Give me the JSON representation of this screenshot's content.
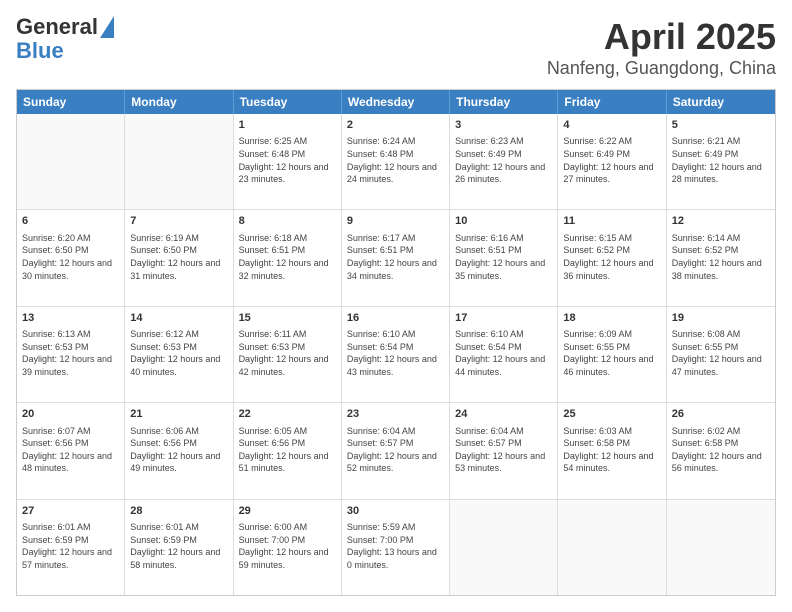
{
  "header": {
    "logo_general": "General",
    "logo_blue": "Blue",
    "title": "April 2025",
    "subtitle": "Nanfeng, Guangdong, China"
  },
  "calendar": {
    "days": [
      "Sunday",
      "Monday",
      "Tuesday",
      "Wednesday",
      "Thursday",
      "Friday",
      "Saturday"
    ],
    "weeks": [
      [
        {
          "day": "",
          "empty": true
        },
        {
          "day": "",
          "empty": true
        },
        {
          "day": "1",
          "sunrise": "6:25 AM",
          "sunset": "6:48 PM",
          "daylight": "12 hours and 23 minutes."
        },
        {
          "day": "2",
          "sunrise": "6:24 AM",
          "sunset": "6:48 PM",
          "daylight": "12 hours and 24 minutes."
        },
        {
          "day": "3",
          "sunrise": "6:23 AM",
          "sunset": "6:49 PM",
          "daylight": "12 hours and 26 minutes."
        },
        {
          "day": "4",
          "sunrise": "6:22 AM",
          "sunset": "6:49 PM",
          "daylight": "12 hours and 27 minutes."
        },
        {
          "day": "5",
          "sunrise": "6:21 AM",
          "sunset": "6:49 PM",
          "daylight": "12 hours and 28 minutes."
        }
      ],
      [
        {
          "day": "6",
          "sunrise": "6:20 AM",
          "sunset": "6:50 PM",
          "daylight": "12 hours and 30 minutes."
        },
        {
          "day": "7",
          "sunrise": "6:19 AM",
          "sunset": "6:50 PM",
          "daylight": "12 hours and 31 minutes."
        },
        {
          "day": "8",
          "sunrise": "6:18 AM",
          "sunset": "6:51 PM",
          "daylight": "12 hours and 32 minutes."
        },
        {
          "day": "9",
          "sunrise": "6:17 AM",
          "sunset": "6:51 PM",
          "daylight": "12 hours and 34 minutes."
        },
        {
          "day": "10",
          "sunrise": "6:16 AM",
          "sunset": "6:51 PM",
          "daylight": "12 hours and 35 minutes."
        },
        {
          "day": "11",
          "sunrise": "6:15 AM",
          "sunset": "6:52 PM",
          "daylight": "12 hours and 36 minutes."
        },
        {
          "day": "12",
          "sunrise": "6:14 AM",
          "sunset": "6:52 PM",
          "daylight": "12 hours and 38 minutes."
        }
      ],
      [
        {
          "day": "13",
          "sunrise": "6:13 AM",
          "sunset": "6:53 PM",
          "daylight": "12 hours and 39 minutes."
        },
        {
          "day": "14",
          "sunrise": "6:12 AM",
          "sunset": "6:53 PM",
          "daylight": "12 hours and 40 minutes."
        },
        {
          "day": "15",
          "sunrise": "6:11 AM",
          "sunset": "6:53 PM",
          "daylight": "12 hours and 42 minutes."
        },
        {
          "day": "16",
          "sunrise": "6:10 AM",
          "sunset": "6:54 PM",
          "daylight": "12 hours and 43 minutes."
        },
        {
          "day": "17",
          "sunrise": "6:10 AM",
          "sunset": "6:54 PM",
          "daylight": "12 hours and 44 minutes."
        },
        {
          "day": "18",
          "sunrise": "6:09 AM",
          "sunset": "6:55 PM",
          "daylight": "12 hours and 46 minutes."
        },
        {
          "day": "19",
          "sunrise": "6:08 AM",
          "sunset": "6:55 PM",
          "daylight": "12 hours and 47 minutes."
        }
      ],
      [
        {
          "day": "20",
          "sunrise": "6:07 AM",
          "sunset": "6:56 PM",
          "daylight": "12 hours and 48 minutes."
        },
        {
          "day": "21",
          "sunrise": "6:06 AM",
          "sunset": "6:56 PM",
          "daylight": "12 hours and 49 minutes."
        },
        {
          "day": "22",
          "sunrise": "6:05 AM",
          "sunset": "6:56 PM",
          "daylight": "12 hours and 51 minutes."
        },
        {
          "day": "23",
          "sunrise": "6:04 AM",
          "sunset": "6:57 PM",
          "daylight": "12 hours and 52 minutes."
        },
        {
          "day": "24",
          "sunrise": "6:04 AM",
          "sunset": "6:57 PM",
          "daylight": "12 hours and 53 minutes."
        },
        {
          "day": "25",
          "sunrise": "6:03 AM",
          "sunset": "6:58 PM",
          "daylight": "12 hours and 54 minutes."
        },
        {
          "day": "26",
          "sunrise": "6:02 AM",
          "sunset": "6:58 PM",
          "daylight": "12 hours and 56 minutes."
        }
      ],
      [
        {
          "day": "27",
          "sunrise": "6:01 AM",
          "sunset": "6:59 PM",
          "daylight": "12 hours and 57 minutes."
        },
        {
          "day": "28",
          "sunrise": "6:01 AM",
          "sunset": "6:59 PM",
          "daylight": "12 hours and 58 minutes."
        },
        {
          "day": "29",
          "sunrise": "6:00 AM",
          "sunset": "7:00 PM",
          "daylight": "12 hours and 59 minutes."
        },
        {
          "day": "30",
          "sunrise": "5:59 AM",
          "sunset": "7:00 PM",
          "daylight": "13 hours and 0 minutes."
        },
        {
          "day": "",
          "empty": true
        },
        {
          "day": "",
          "empty": true
        },
        {
          "day": "",
          "empty": true
        }
      ]
    ]
  }
}
